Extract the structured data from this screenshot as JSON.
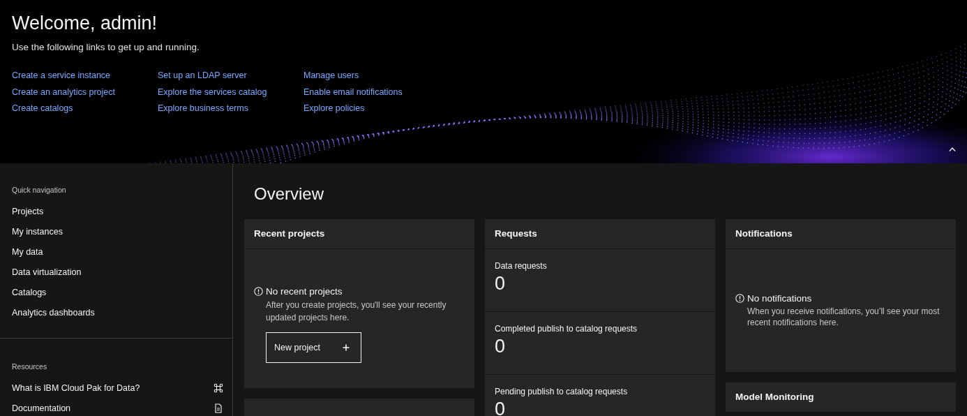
{
  "hero": {
    "title": "Welcome, admin!",
    "subtitle": "Use the following links to get up and running.",
    "link_columns": [
      [
        "Create a service instance",
        "Create an analytics project",
        "Create catalogs"
      ],
      [
        "Set up an LDAP server",
        "Explore the services catalog",
        "Explore business terms"
      ],
      [
        "Manage users",
        "Enable email notifications",
        "Explore policies"
      ]
    ]
  },
  "sidebar": {
    "sections": [
      {
        "heading": "Quick navigation",
        "items": [
          {
            "label": "Projects"
          },
          {
            "label": "My instances"
          },
          {
            "label": "My data"
          },
          {
            "label": "Data virtualization"
          },
          {
            "label": "Catalogs"
          },
          {
            "label": "Analytics dashboards"
          }
        ]
      },
      {
        "heading": "Resources",
        "items": [
          {
            "label": "What is IBM Cloud Pak for Data?"
          },
          {
            "label": "Documentation"
          }
        ]
      }
    ]
  },
  "main": {
    "title": "Overview",
    "columns": [
      [
        {
          "kind": "empty",
          "title": "Recent projects",
          "message": "No recent projects",
          "detail": "After you create projects, you'll see your recently updated projects here.",
          "button": "New project"
        },
        {
          "kind": "blank"
        }
      ],
      [
        {
          "kind": "stats",
          "title": "Requests",
          "stats": [
            {
              "label": "Data requests",
              "value": "0"
            },
            {
              "label": "Completed publish to catalog requests",
              "value": "0"
            },
            {
              "label": "Pending publish to catalog requests",
              "value": "0"
            }
          ]
        }
      ],
      [
        {
          "kind": "empty",
          "title": "Notifications",
          "message": "No notifications",
          "detail": "When you receive notifications, you’ll see your most recent notifications here."
        },
        {
          "kind": "header",
          "title": "Model Monitoring"
        }
      ]
    ]
  }
}
